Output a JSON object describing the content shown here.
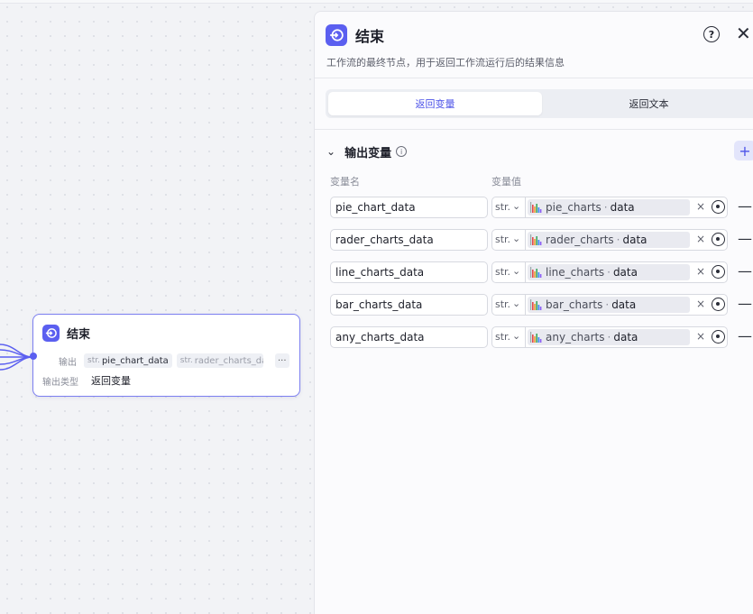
{
  "node": {
    "title": "结束",
    "output_label": "输出",
    "output_chips": [
      {
        "type": "str.",
        "name": "pie_chart_data"
      },
      {
        "type": "str.",
        "name": "rader_charts_data"
      }
    ],
    "more_label": "···",
    "output_type_label": "输出类型",
    "output_type_value": "返回变量"
  },
  "panel": {
    "title": "结束",
    "description": "工作流的最终节点，用于返回工作流运行后的结果信息",
    "help_icon": "?",
    "close_icon": "✕",
    "tabs": [
      {
        "label": "返回变量",
        "active": true
      },
      {
        "label": "返回文本",
        "active": false
      }
    ],
    "section_title": "输出变量",
    "add_icon": "+",
    "col_name": "变量名",
    "col_value": "变量值",
    "rows": [
      {
        "name": "pie_chart_data",
        "type": "str.",
        "ref_node": "pie_charts",
        "ref_key": "data"
      },
      {
        "name": "rader_charts_data",
        "type": "str.",
        "ref_node": "rader_charts",
        "ref_key": "data"
      },
      {
        "name": "line_charts_data",
        "type": "str.",
        "ref_node": "line_charts",
        "ref_key": "data"
      },
      {
        "name": "bar_charts_data",
        "type": "str.",
        "ref_node": "bar_charts",
        "ref_key": "data"
      },
      {
        "name": "any_charts_data",
        "type": "str.",
        "ref_node": "any_charts",
        "ref_key": "data"
      }
    ]
  },
  "colors": {
    "accent": "#5b5ff0",
    "tab_active": "#4d53e8"
  }
}
